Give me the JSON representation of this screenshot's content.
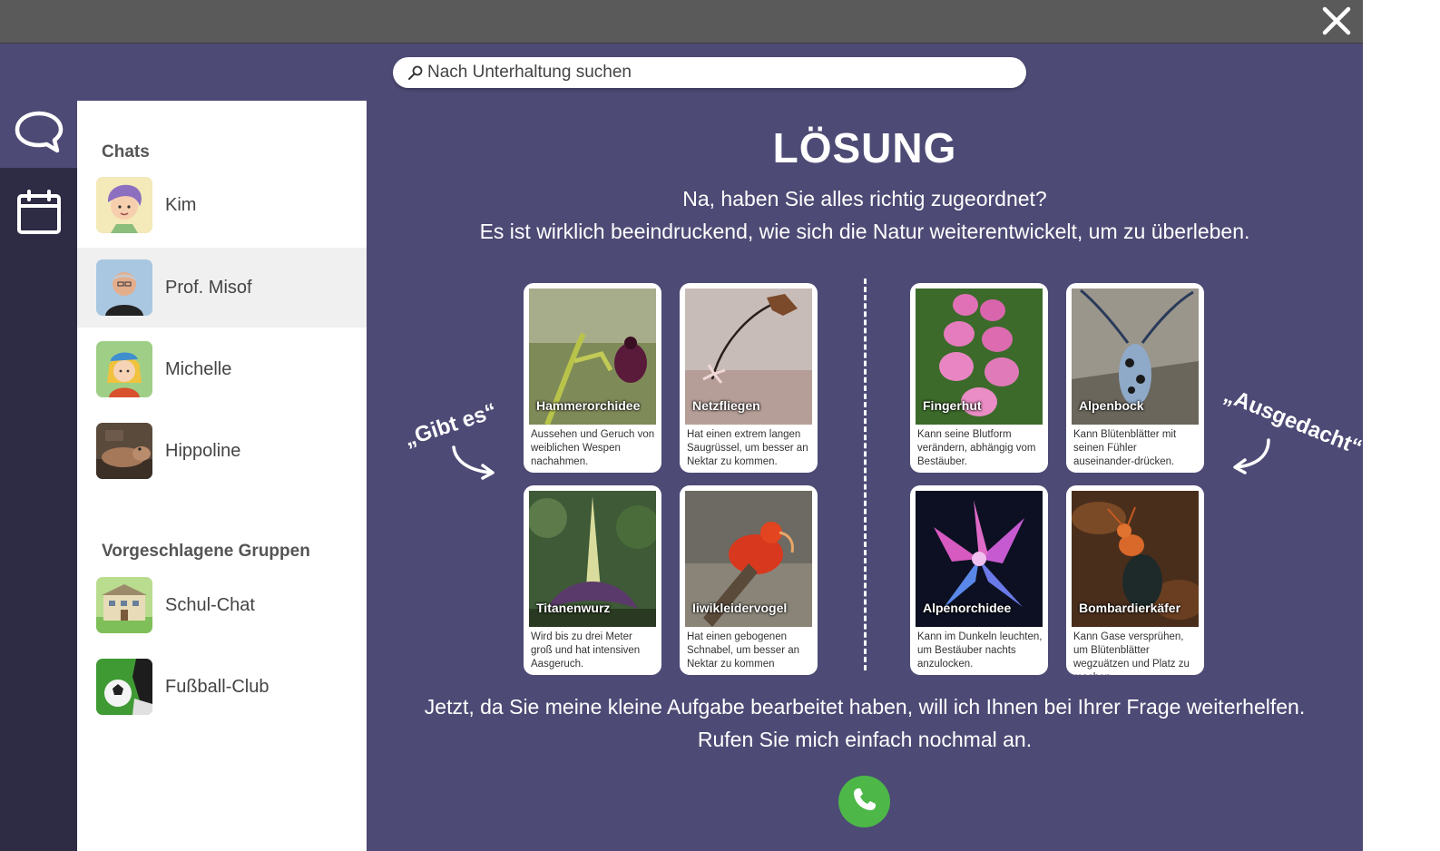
{
  "search": {
    "placeholder": "Nach Unterhaltung suchen"
  },
  "rail": {
    "items": [
      {
        "icon": "chat-icon",
        "active": true
      },
      {
        "icon": "calendar-icon",
        "active": false
      }
    ]
  },
  "sidebar": {
    "chats_title": "Chats",
    "chats": [
      {
        "name": "Kim"
      },
      {
        "name": "Prof. Misof",
        "selected": true
      },
      {
        "name": "Michelle"
      },
      {
        "name": "Hippoline"
      }
    ],
    "groups_title": "Vorgeschlagene Gruppen",
    "groups": [
      {
        "name": "Schul-Chat"
      },
      {
        "name": "Fußball-Club"
      }
    ]
  },
  "main": {
    "headline": "LÖSUNG",
    "intro_line1": "Na, haben Sie alles richtig zugeordnet?",
    "intro_line2": "Es ist wirklich beeindruckend, wie sich die Natur weiterentwickelt, um zu überleben.",
    "left_label": "„Gibt es“",
    "right_label": "„Ausgedacht“",
    "cards": [
      {
        "title": "Hammerorchidee",
        "text": "Aussehen und Geruch von weiblichen Wespen nachahmen."
      },
      {
        "title": "Netzfliegen",
        "text": "Hat einen extrem langen Saugrüssel, um besser an Nektar zu kommen."
      },
      {
        "title": "Titanenwurz",
        "text": "Wird bis zu drei Meter groß und hat intensiven Aasgeruch."
      },
      {
        "title": "Iiwikleidervogel",
        "text": "Hat einen gebogenen Schnabel, um besser an Nektar zu kommen"
      },
      {
        "title": "Fingerhut",
        "text": "Kann seine Blutform verändern, abhängig vom Bestäuber."
      },
      {
        "title": "Alpenbock",
        "text": "Kann Blütenblätter mit seinen Fühler auseinander-drücken."
      },
      {
        "title": "Alpenorchidee",
        "text": "Kann im Dunkeln leuchten, um Bestäuber nachts anzulocken."
      },
      {
        "title": "Bombardierkäfer",
        "text": "Kann Gase versprühen, um Blütenblätter wegzuätzen und Platz zu machen."
      }
    ],
    "outro_line1": "Jetzt, da Sie meine kleine Aufgabe bearbeitet haben, will ich Ihnen bei Ihrer Frage weiterhelfen.",
    "outro_line2": "Rufen Sie mich einfach nochmal an."
  },
  "colors": {
    "accent_purple": "#4d4a75",
    "rail_dark": "#2e2c44",
    "call_green": "#4db848",
    "titlebar_grey": "#5a5a5a"
  }
}
